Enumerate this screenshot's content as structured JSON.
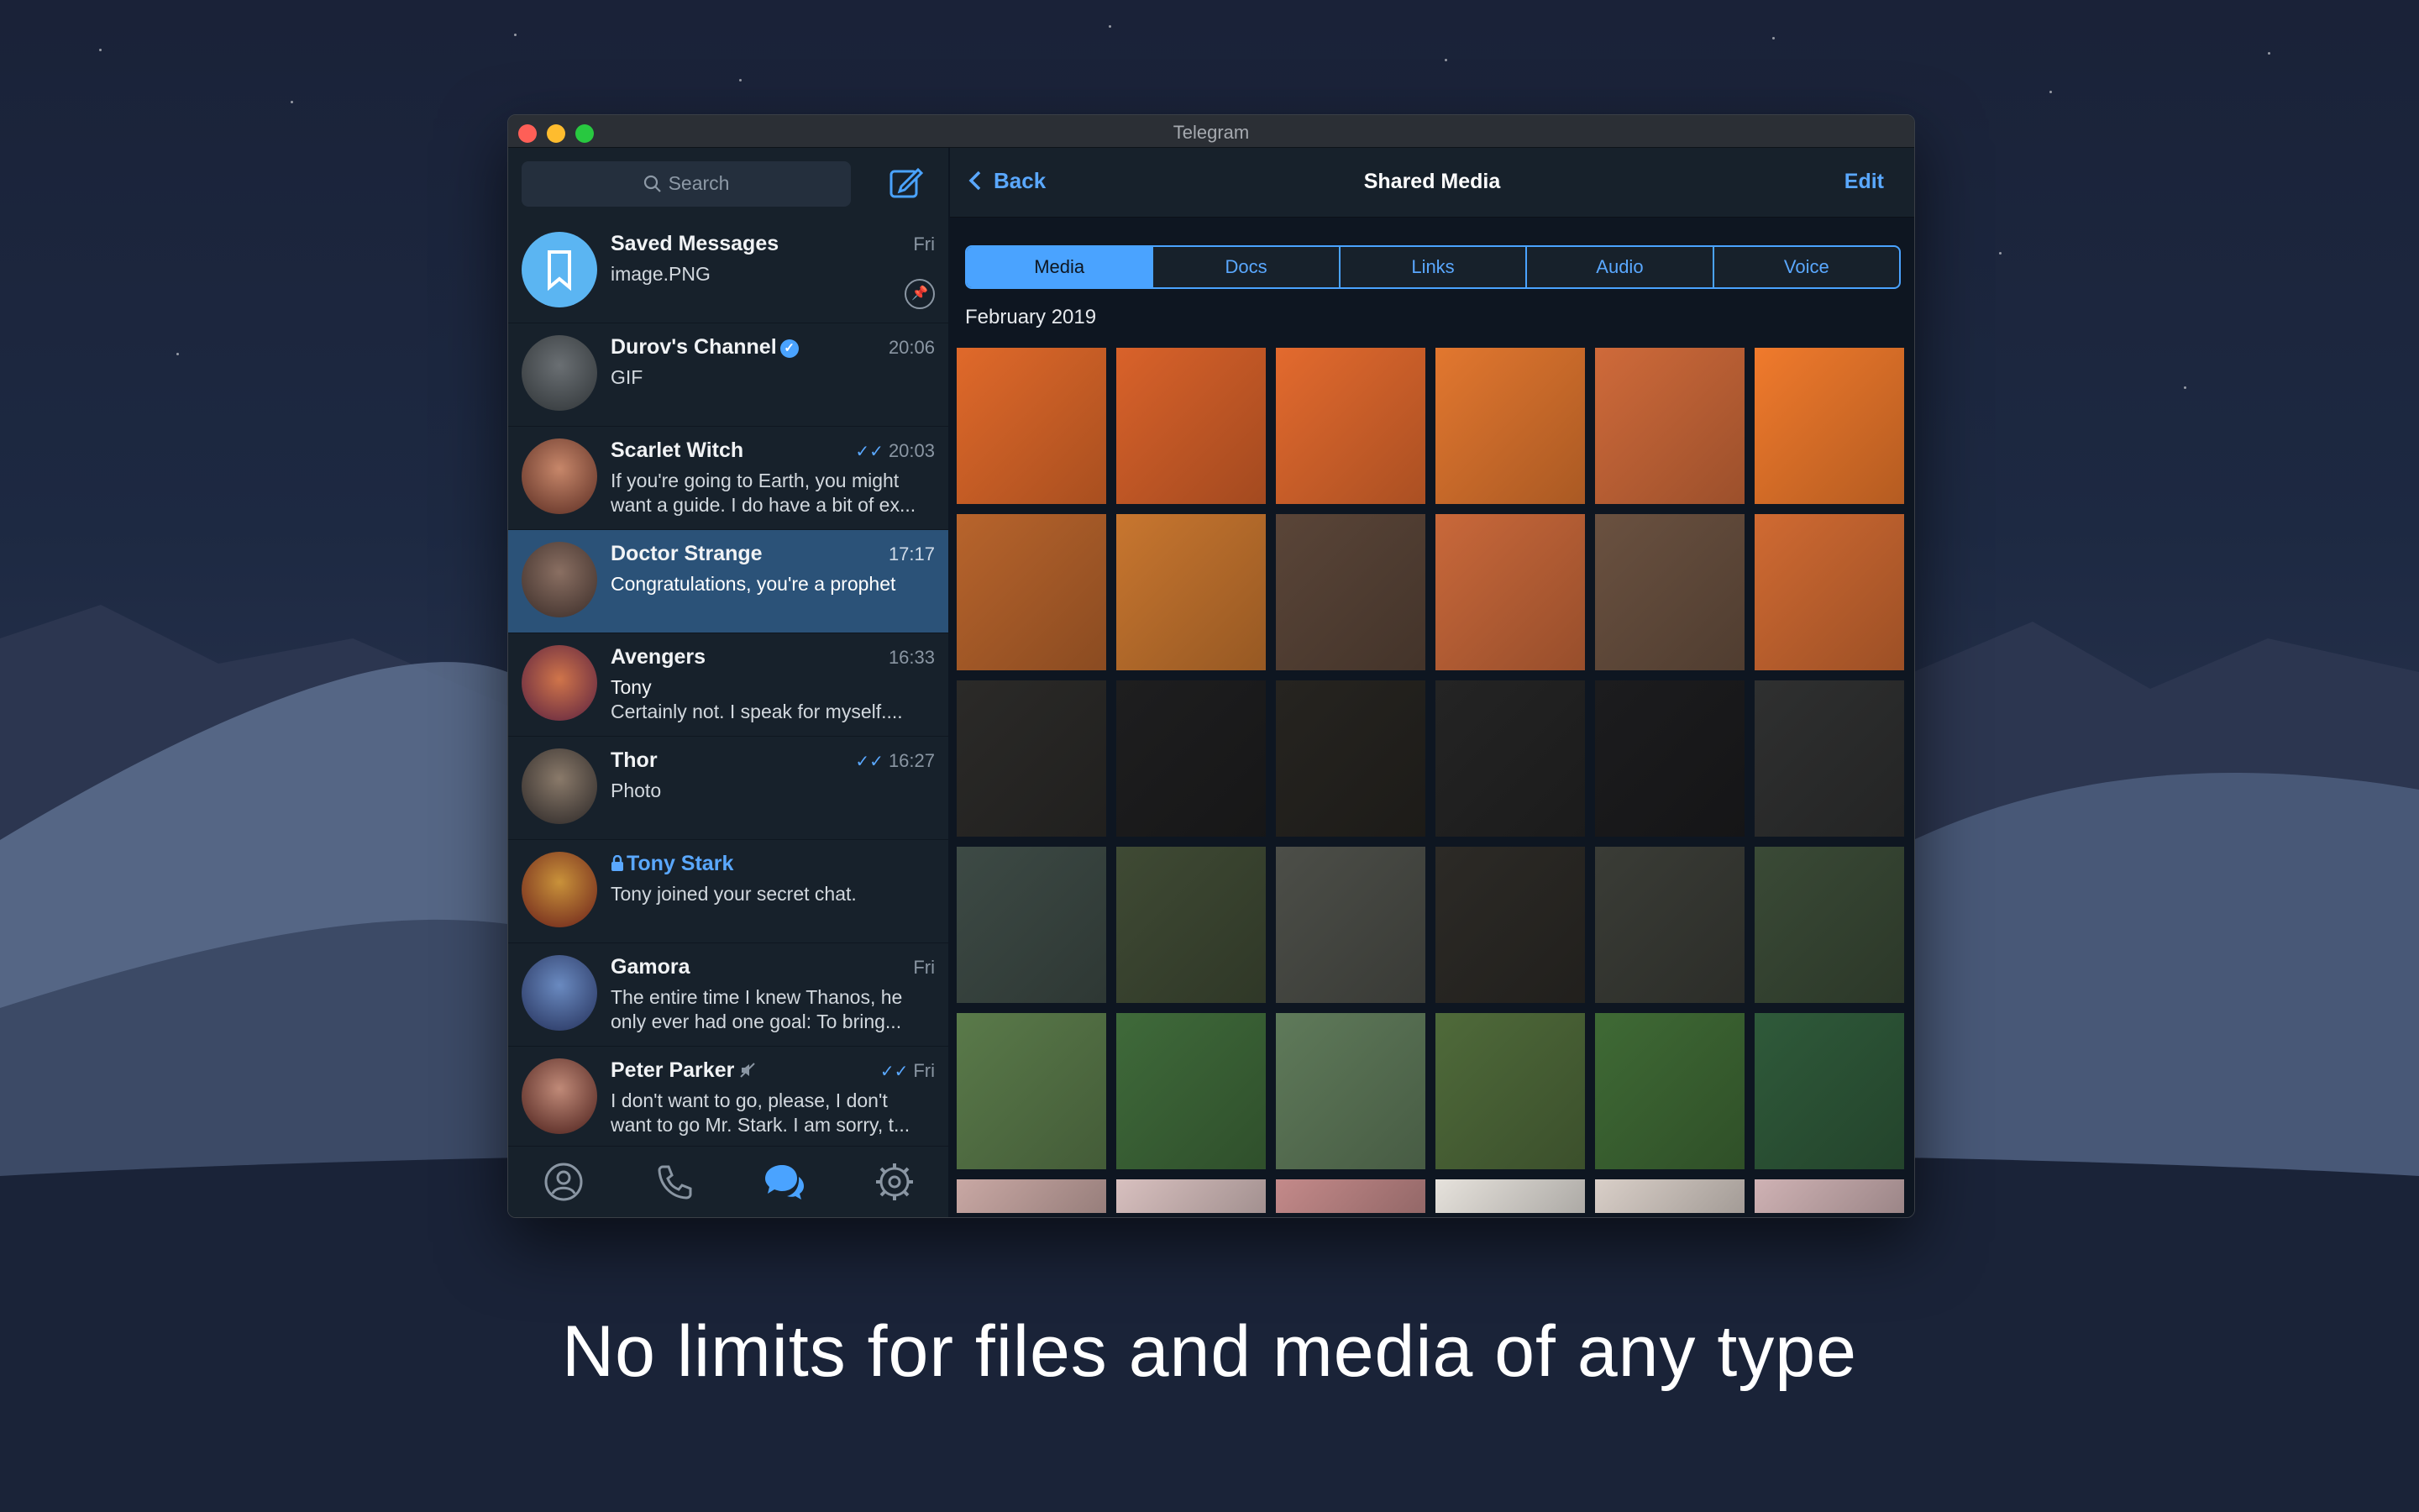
{
  "window": {
    "title": "Telegram"
  },
  "search": {
    "placeholder": "Search"
  },
  "chats": [
    {
      "name": "Saved Messages",
      "time": "Fri",
      "message": "image.PNG",
      "pinned": true,
      "avatar_color": "#5bb5f2"
    },
    {
      "name": "Durov's Channel",
      "time": "20:06",
      "message": "GIF",
      "verified": true,
      "avatar_color": "#3b4248"
    },
    {
      "name": "Scarlet Witch",
      "time": "20:03",
      "message": "If you're going to Earth, you might want a guide. I do have a bit of ex...",
      "read": true,
      "avatar_color": "#8a4a3a"
    },
    {
      "name": "Doctor Strange",
      "time": "17:17",
      "message": "Congratulations, you're a prophet",
      "active": true,
      "avatar_color": "#5a4a44"
    },
    {
      "name": "Avengers",
      "time": "16:33",
      "sender": "Tony",
      "message": "Certainly not. I speak for myself....",
      "avatar_color": "#7a3b52"
    },
    {
      "name": "Thor",
      "time": "16:27",
      "message": "Photo",
      "read": true,
      "avatar_color": "#4d4a4a"
    },
    {
      "name": "Tony Stark",
      "time": "",
      "message": "Tony joined your secret chat.",
      "secret": true,
      "avatar_color": "#7a2f25"
    },
    {
      "name": "Gamora",
      "time": "Fri",
      "message": "The entire time I knew Thanos, he only ever had one goal: To bring...",
      "avatar_color": "#3e4f7a"
    },
    {
      "name": "Peter Parker",
      "time": "Fri",
      "message": "I don't want to go, please, I don't want to go Mr. Stark. I am sorry, t...",
      "read": true,
      "muted": true,
      "avatar_color": "#5a3028"
    }
  ],
  "bottom_tabs": [
    "contacts-icon",
    "calls-icon",
    "chats-icon",
    "settings-icon"
  ],
  "header": {
    "back_label": "Back",
    "title": "Shared Media",
    "edit_label": "Edit"
  },
  "media_tabs": [
    "Media",
    "Docs",
    "Links",
    "Audio",
    "Voice"
  ],
  "active_media_tab": "Media",
  "month_label": "February 2019",
  "media_tiles": [
    "#e0692a",
    "#d9622a",
    "#e36a2e",
    "#e2772f",
    "#cf6a3a",
    "#f07a2c",
    "#b8642c",
    "#c8762f",
    "#5a4538",
    "#c9683a",
    "#6a5140",
    "#d06a32",
    "#2b2a28",
    "#1e1e1f",
    "#262420",
    "#242424",
    "#1c1c1e",
    "#2f3030",
    "#3d4a45",
    "#3f4a34",
    "#4c4e48",
    "#2c2a26",
    "#3a3c36",
    "#3a4a36",
    "#5a7a4a",
    "#3f6a3a",
    "#5f7a5a",
    "#4f6a3a",
    "#3f6a35",
    "#2f5a3a",
    "#c9a8a4",
    "#d8c0bf",
    "#c48a8a",
    "#e6e2dc",
    "#d9cfc8",
    "#cfb2b4"
  ],
  "tagline": "No limits for files and media of any type",
  "colors": {
    "accent": "#4aa3ff",
    "active_chat": "#2b5278",
    "sidebar_bg": "#17212b",
    "main_bg": "#0e1621"
  }
}
